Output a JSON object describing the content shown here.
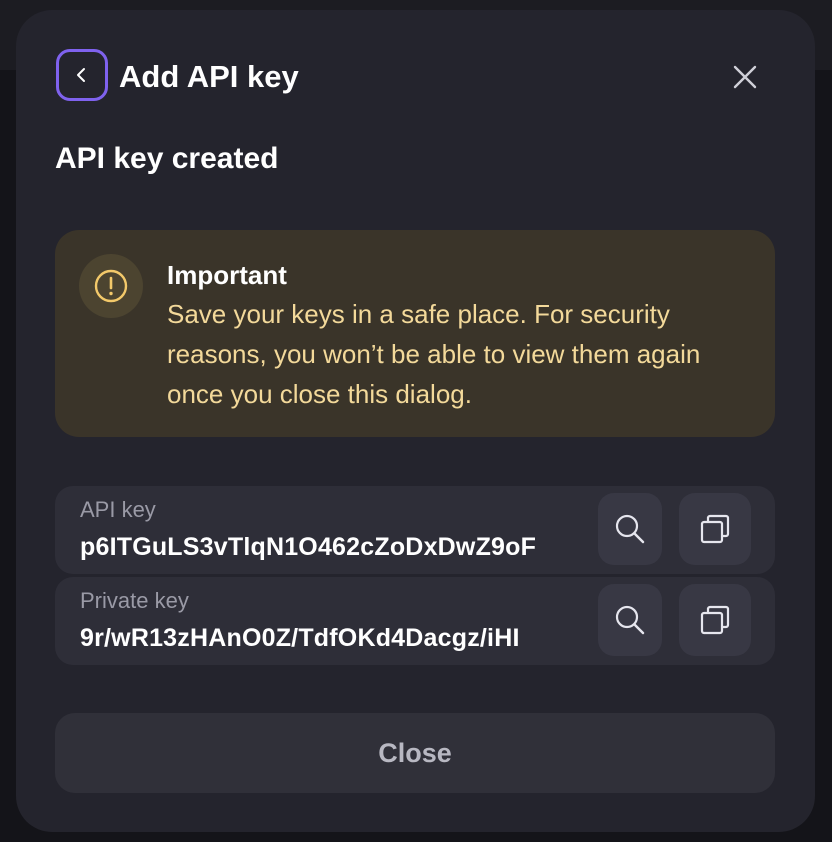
{
  "dialog": {
    "title": "Add API key",
    "subtitle": "API key created"
  },
  "alert": {
    "heading": "Important",
    "body": "Save your keys in a safe place. For security reasons, you won’t be able to view them again once you close this dialog.",
    "icon": "exclamation-circle-icon",
    "accent_color": "#f3c96a"
  },
  "keys": [
    {
      "label": "API key",
      "value": "p6ITGuLS3vTlqN1O462cZoDxDwZ9oF"
    },
    {
      "label": "Private key",
      "value": "9r/wR13zHAnO0Z/TdfOKd4Dacgz/iHI"
    }
  ],
  "footer": {
    "close_label": "Close"
  },
  "colors": {
    "dialog_bg": "#24242d",
    "focus_ring": "#7f62ee",
    "alert_bg": "#3a3429",
    "alert_text": "#f3d99a"
  }
}
